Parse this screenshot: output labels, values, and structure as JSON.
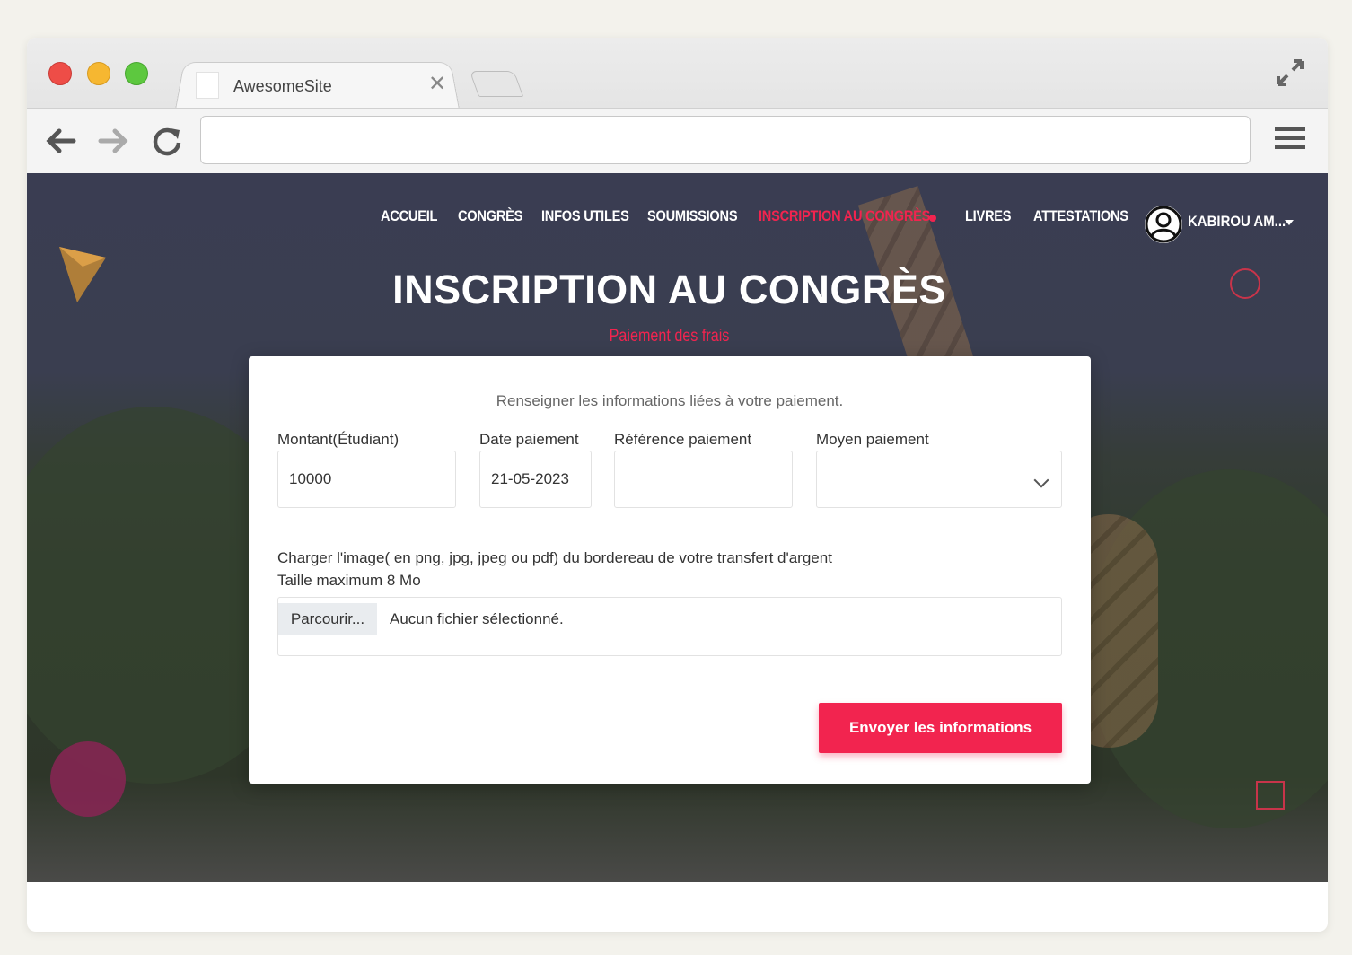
{
  "browser": {
    "tab_title": "AwesomeSite",
    "tab_close": "✕",
    "url": ""
  },
  "site": {
    "nav": [
      "ACCUEIL",
      "CONGRÈS",
      "INFOS UTILES",
      "SOUMISSIONS",
      "INSCRIPTION AU CONGRÈS",
      "LIVRES",
      "ATTESTATIONS"
    ],
    "active_nav": "INSCRIPTION AU CONGRÈS",
    "user_name": "KABIROU AM...",
    "accent_color": "#f2244f"
  },
  "hero": {
    "title": "INSCRIPTION AU CONGRÈS",
    "subtitle": "Paiement des frais"
  },
  "form": {
    "intro": "Renseigner les informations liées à votre paiement.",
    "montant_label": "Montant(Étudiant)",
    "montant_value": "10000",
    "date_label": "Date paiement",
    "date_value": "21-05-2023",
    "reference_label": "Référence paiement",
    "reference_value": "",
    "moyen_label": "Moyen paiement",
    "moyen_value": "",
    "upload_line1": "Charger l'image( en png, jpg, jpeg ou pdf) du bordereau de votre transfert d'argent",
    "upload_line2": "Taille maximum 8 Mo",
    "browse_label": "Parcourir...",
    "file_status": "Aucun fichier sélectionné.",
    "submit_label": "Envoyer les informations"
  }
}
